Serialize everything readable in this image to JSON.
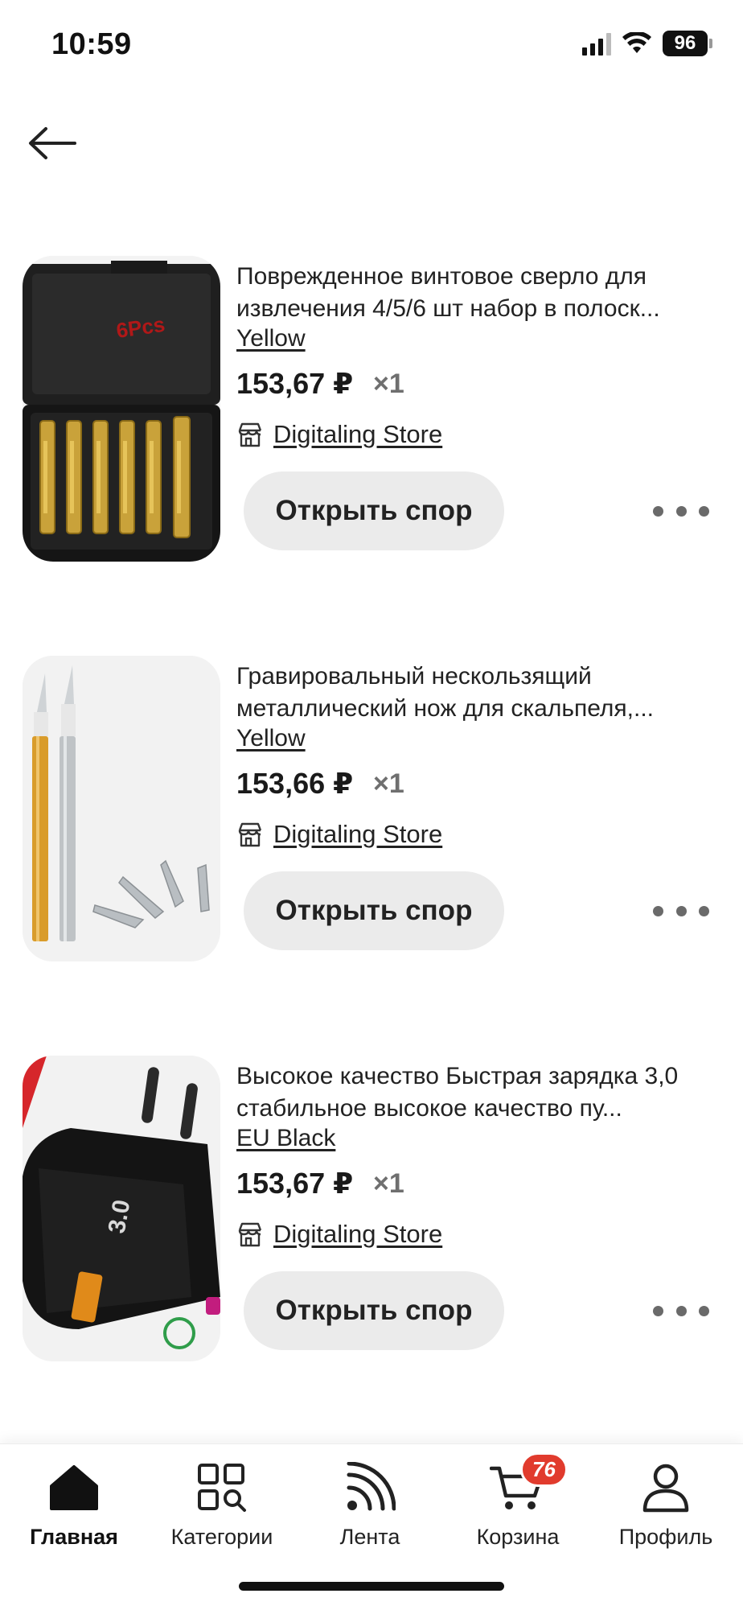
{
  "status_bar": {
    "time": "10:59",
    "battery": "96"
  },
  "header": {
    "back_icon": "arrow-left-icon"
  },
  "products": [
    {
      "title": "Поврежденное винтовое сверло для извлечения 4/5/6 шт набор в полоск...",
      "variant": "Yellow",
      "price": "153,67 ₽",
      "quantity": "×1",
      "store": "Digitaling Store",
      "dispute_label": "Открыть спор",
      "image_caption": "6Pcs"
    },
    {
      "title": "Гравировальный нескользящий металлический нож для скальпеля,...",
      "variant": "Yellow",
      "price": "153,66 ₽",
      "quantity": "×1",
      "store": "Digitaling Store",
      "dispute_label": "Открыть спор"
    },
    {
      "title": "Высокое качество Быстрая зарядка 3,0 стабильное высокое качество пу...",
      "variant": "EU Black",
      "price": "153,67 ₽",
      "quantity": "×1",
      "store": "Digitaling Store",
      "dispute_label": "Открыть спор",
      "image_caption": "3.0"
    }
  ],
  "bottom_nav": {
    "items": [
      {
        "label": "Главная",
        "icon": "home-icon",
        "active": true
      },
      {
        "label": "Категории",
        "icon": "categories-icon",
        "active": false
      },
      {
        "label": "Лента",
        "icon": "feed-icon",
        "active": false
      },
      {
        "label": "Корзина",
        "icon": "cart-icon",
        "active": false,
        "badge": "76"
      },
      {
        "label": "Профиль",
        "icon": "profile-icon",
        "active": false
      }
    ]
  },
  "colors": {
    "accent_badge": "#e13b2d",
    "button_bg": "#ebebeb",
    "text": "#1a1a1a",
    "muted": "#6f6f6f"
  }
}
